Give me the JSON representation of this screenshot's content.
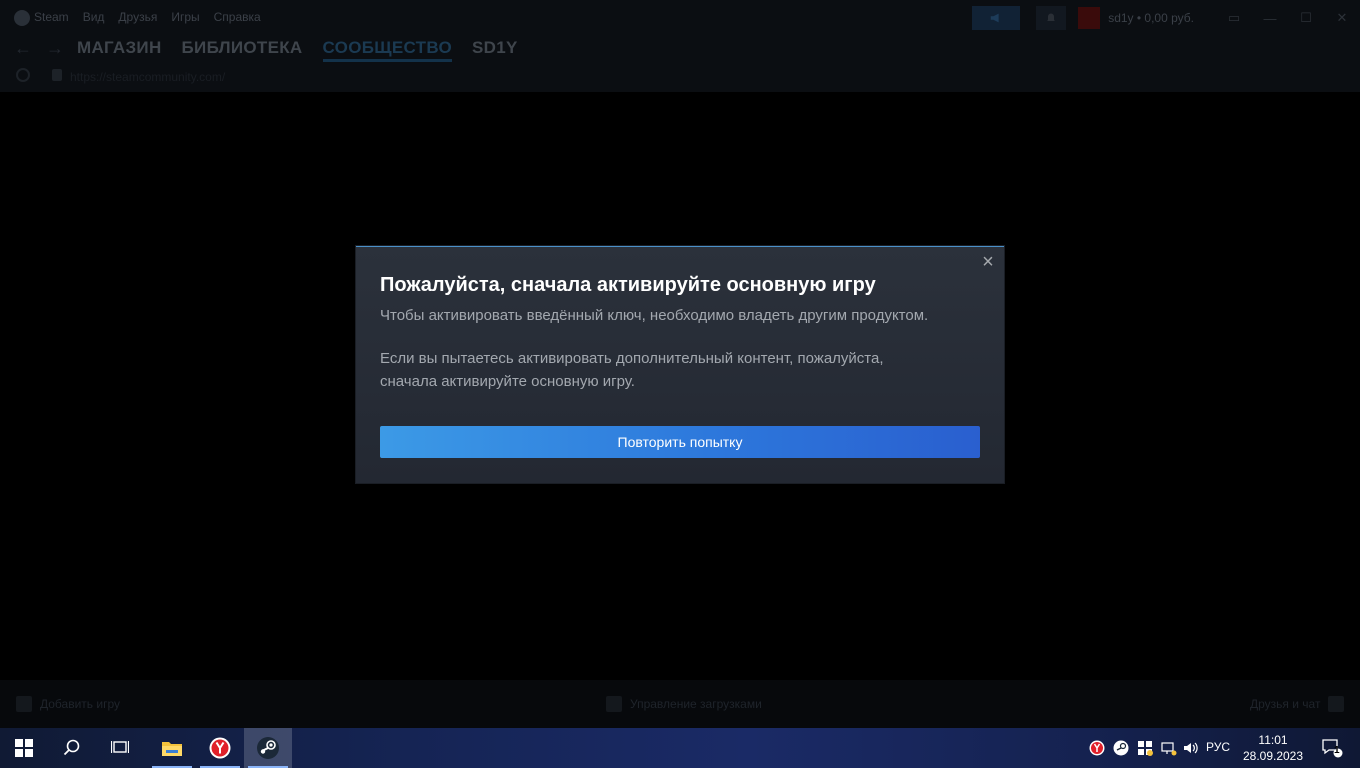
{
  "steam": {
    "menu": [
      "Steam",
      "Вид",
      "Друзья",
      "Игры",
      "Справка"
    ],
    "user": "sd1y • 0,00 руб.",
    "nav": {
      "store": "МАГАЗИН",
      "library": "БИБЛИОТЕКА",
      "community": "СООБЩЕСТВО",
      "profile": "SD1Y"
    },
    "url": "https://steamcommunity.com/",
    "bottom": {
      "add_game": "Добавить игру",
      "downloads": "Управление загрузками",
      "friends": "Друзья и чат"
    }
  },
  "modal": {
    "title": "Пожалуйста, сначала активируйте основную игру",
    "line1": "Чтобы активировать введённый ключ, необходимо владеть другим продуктом.",
    "line2": "Если вы пытаетесь активировать дополнительный контент, пожалуйста,",
    "line3": "сначала активируйте основную игру.",
    "button": "Повторить попытку",
    "close": "×"
  },
  "taskbar": {
    "lang": "РУС",
    "time": "11:01",
    "date": "28.09.2023",
    "notifications": "1"
  },
  "colors": {
    "accent": "#3c9ae6",
    "modal_bg": "#2b313b",
    "taskbar": "#152454"
  }
}
